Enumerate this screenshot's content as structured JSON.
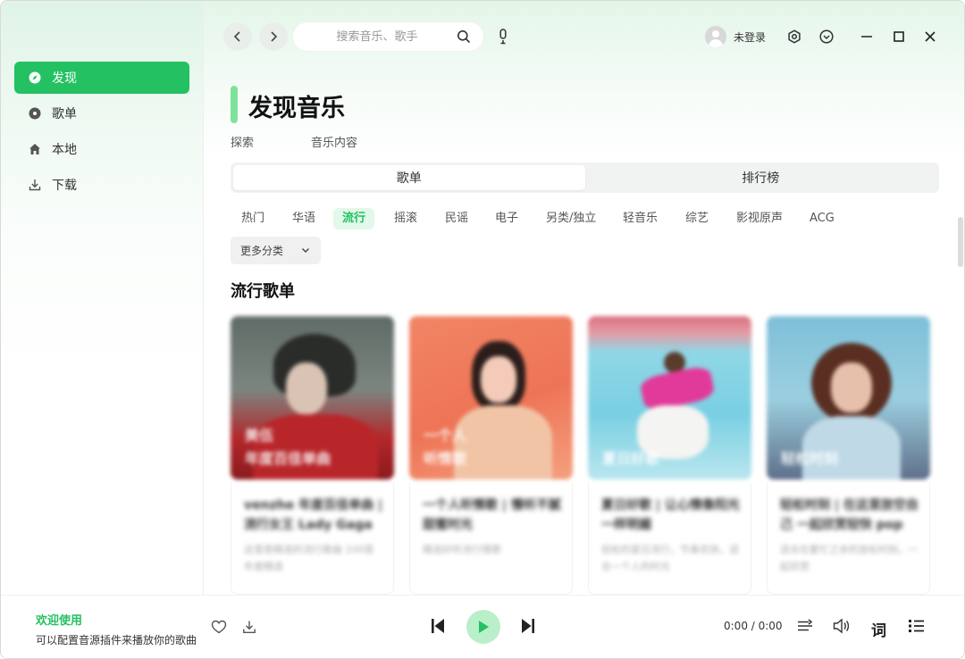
{
  "sidebar": {
    "items": [
      {
        "label": "发现",
        "icon": "compass-icon",
        "active": true
      },
      {
        "label": "歌单",
        "icon": "disc-icon",
        "active": false
      },
      {
        "label": "本地",
        "icon": "home-icon",
        "active": false
      },
      {
        "label": "下载",
        "icon": "download-icon",
        "active": false
      }
    ]
  },
  "header": {
    "search_placeholder": "搜索音乐、歌手",
    "user_label": "未登录"
  },
  "main": {
    "title": "发现音乐",
    "subnav": [
      "探索",
      "音乐内容"
    ],
    "segments": [
      {
        "label": "歌单",
        "active": true
      },
      {
        "label": "排行榜",
        "active": false
      }
    ],
    "tags": [
      {
        "label": "热门",
        "active": false
      },
      {
        "label": "华语",
        "active": false
      },
      {
        "label": "流行",
        "active": true
      },
      {
        "label": "摇滚",
        "active": false
      },
      {
        "label": "民谣",
        "active": false
      },
      {
        "label": "电子",
        "active": false
      },
      {
        "label": "另类/独立",
        "active": false
      },
      {
        "label": "轻音乐",
        "active": false
      },
      {
        "label": "综艺",
        "active": false
      },
      {
        "label": "影视原声",
        "active": false
      },
      {
        "label": "ACG",
        "active": false
      }
    ],
    "more_label": "更多分类",
    "section_title": "流行歌单",
    "playlists": [
      {
        "cover_text": "美伍\n年度百佳单曲",
        "title": "venzhe 年度百佳单曲 | 流行女王 Lady Gaga",
        "desc": "这里是精选的流行歌曲 100首年度精选"
      },
      {
        "cover_text": "一个人\n听情歌",
        "title": "一个人听情歌 | 慢听不腻 甜蜜时光",
        "desc": "精选好听流行情歌"
      },
      {
        "cover_text": "夏日好歌",
        "title": "夏日好歌 | 让心情像阳光 一样明媚",
        "desc": "轻松的夏日流行，节奏欢快，适合一个人的时光"
      },
      {
        "cover_text": "轻松时刻",
        "title": "轻松时刻 | 在这里放空自己 一起欣赏轻快 pop",
        "desc": "适合在繁忙之余的放松时刻，一起欣赏"
      }
    ]
  },
  "player": {
    "welcome": "欢迎使用",
    "hint": "可以配置音源插件来播放你的歌曲",
    "time": "0:00 / 0:00"
  },
  "colors": {
    "accent": "#23c162",
    "accent_light": "#b9efc9"
  }
}
